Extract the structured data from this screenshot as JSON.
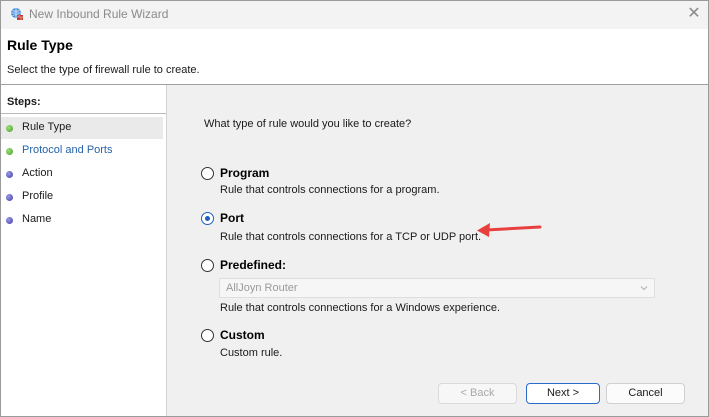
{
  "window": {
    "title": "New Inbound Rule Wizard",
    "close_glyph": "✕"
  },
  "header": {
    "title": "Rule Type",
    "description": "Select the type of firewall rule to create."
  },
  "steps": {
    "heading": "Steps:",
    "items": [
      {
        "label": "Rule Type",
        "status": "complete",
        "active": true
      },
      {
        "label": "Protocol and Ports",
        "status": "complete",
        "active": false
      },
      {
        "label": "Action",
        "status": "pending",
        "active": false
      },
      {
        "label": "Profile",
        "status": "pending",
        "active": false
      },
      {
        "label": "Name",
        "status": "pending",
        "active": false
      }
    ]
  },
  "content": {
    "question": "What type of rule would you like to create?",
    "options": [
      {
        "label": "Program",
        "description": "Rule that controls connections for a program.",
        "selected": false
      },
      {
        "label": "Port",
        "description": "Rule that controls connections for a TCP or UDP port.",
        "selected": true
      },
      {
        "label": "Predefined:",
        "description": "Rule that controls connections for a Windows experience.",
        "selected": false
      },
      {
        "label": "Custom",
        "description": "Custom rule.",
        "selected": false
      }
    ],
    "predefined_dropdown": {
      "value": "AllJoyn Router",
      "enabled": false
    }
  },
  "buttons": {
    "back": "< Back",
    "next": "Next >",
    "cancel": "Cancel"
  },
  "colors": {
    "accent": "#1f5fbf",
    "annotation_arrow": "#e8403f",
    "step_complete": "#4a9c2c",
    "step_pending": "#3f3ea8"
  },
  "icons": {
    "app": "firewall-globe-icon",
    "close": "close-icon",
    "dropdown": "chevron-down-icon"
  }
}
